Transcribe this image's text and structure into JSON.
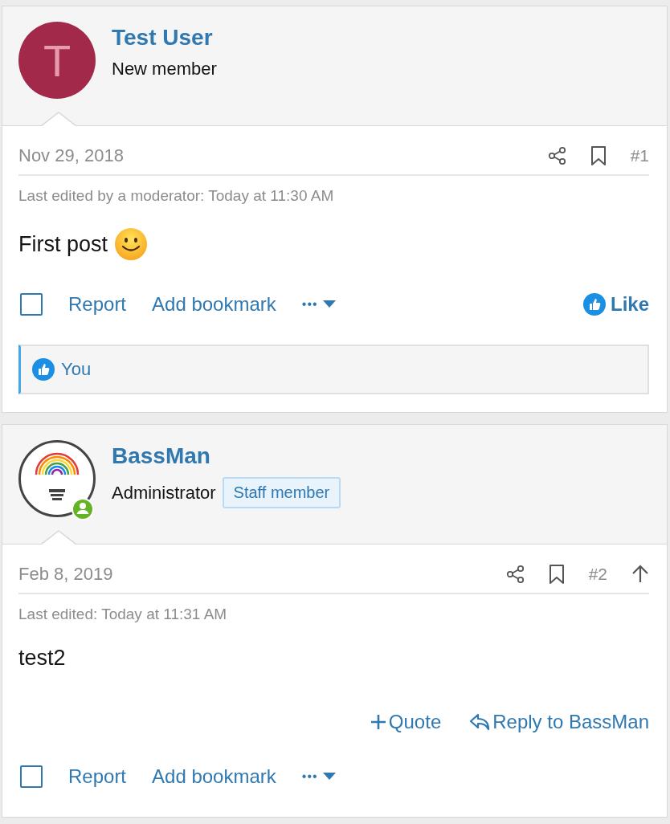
{
  "posts": [
    {
      "author": {
        "name": "Test User",
        "title": "New member",
        "avatar": {
          "kind": "letter",
          "letter": "T",
          "color": "#a3294a"
        },
        "online": false
      },
      "date": "Nov 29, 2018",
      "number": "#1",
      "up_link": false,
      "edited": "Last edited by a moderator: Today at 11:30 AM",
      "body": "First post",
      "emoji": true,
      "checkbox": {
        "checked": false
      },
      "actions": [
        "Report",
        "Add bookmark"
      ],
      "more": "•••",
      "like": "Like",
      "likes": "You"
    },
    {
      "author": {
        "name": "BassMan",
        "title": "Administrator",
        "badge": "Staff member",
        "avatar": {
          "kind": "logo"
        },
        "online": true
      },
      "date": "Feb 8, 2019",
      "number": "#2",
      "up_link": true,
      "edited": "Last edited: Today at 11:31 AM",
      "body": "test2",
      "reply_actions": [
        {
          "kind": "quote",
          "label": "Quote"
        },
        {
          "kind": "reply",
          "label": "Reply to BassMan"
        }
      ],
      "checkbox": {
        "checked": false
      },
      "actions": [
        "Report",
        "Add bookmark"
      ],
      "more": "•••"
    }
  ]
}
